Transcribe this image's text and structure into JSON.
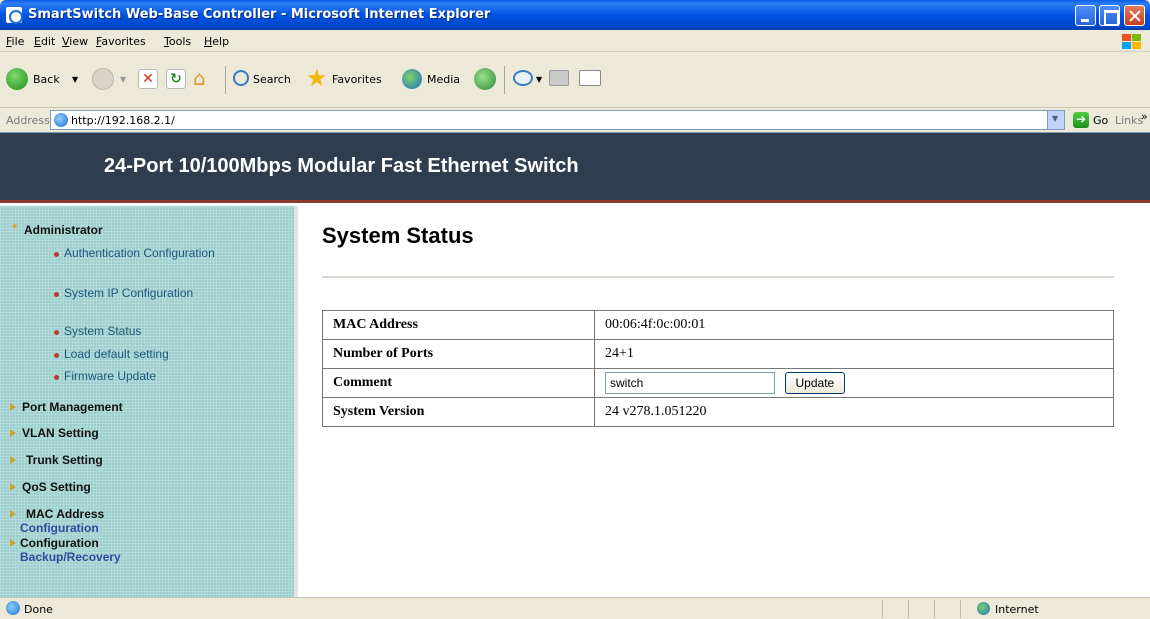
{
  "window": {
    "title": "SmartSwitch Web-Base Controller - Microsoft Internet Explorer"
  },
  "menubar": [
    "File",
    "Edit",
    "View",
    "Favorites",
    "Tools",
    "Help"
  ],
  "toolbar": {
    "back": "Back",
    "search": "Search",
    "favorites": "Favorites",
    "media": "Media"
  },
  "addressbar": {
    "label": "Address",
    "url": "http://192.168.2.1/",
    "go": "Go",
    "links": "Links"
  },
  "banner": {
    "title": "24-Port 10/100Mbps Modular Fast Ethernet Switch"
  },
  "sidebar": {
    "administrator": "Administrator",
    "admin_items": [
      "Authentication Configuration",
      "System IP Configuration",
      "System Status",
      "Load default setting",
      "Firmware Update"
    ],
    "sections": [
      "Port Management",
      "VLAN Setting",
      "Trunk Setting",
      "QoS Setting",
      "MAC Address"
    ],
    "mac_sub": "Configuration",
    "config": "Configuration",
    "config_sub": "Backup/Recovery"
  },
  "main": {
    "title": "System Status",
    "rows": [
      {
        "key": "MAC Address",
        "value": "00:06:4f:0c:00:01"
      },
      {
        "key": "Number of Ports",
        "value": "24+1"
      },
      {
        "key": "Comment",
        "input_value": "switch",
        "button": "Update"
      },
      {
        "key": "System Version",
        "value": "24 v278.1.051220"
      }
    ]
  },
  "statusbar": {
    "text": "Done",
    "zone": "Internet"
  },
  "colors": {
    "banner": "#2f3e4f",
    "sidebar": "#9ccfce",
    "sidebar_link": "#1d5a7a",
    "titlebar": "#0054e3"
  }
}
